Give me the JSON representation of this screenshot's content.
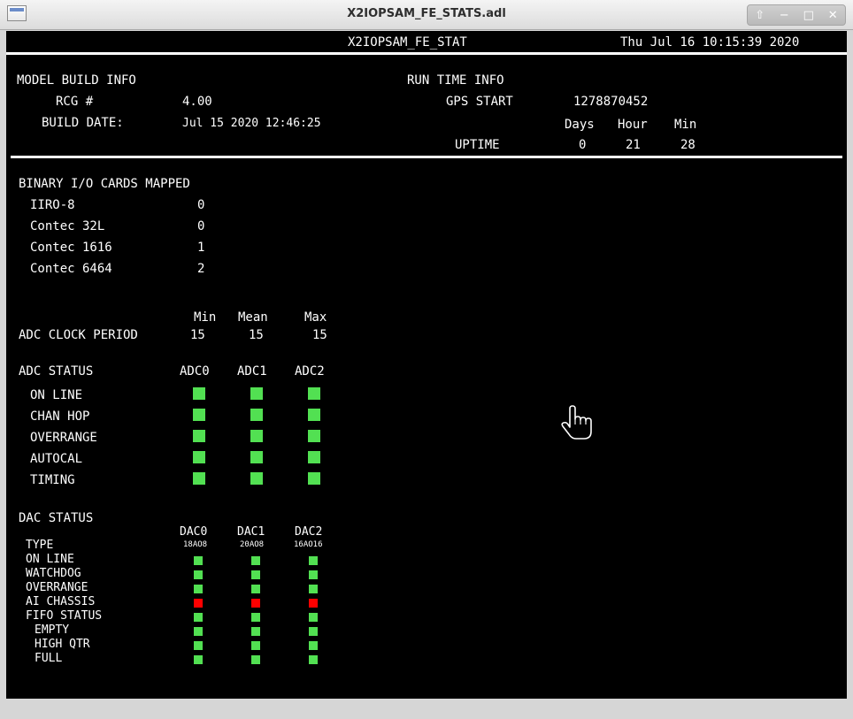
{
  "window": {
    "title": "X2IOPSAM_FE_STATS.adl",
    "controls": {
      "up": "⇧",
      "minimize": "−",
      "maximize": "□",
      "close": "✕"
    }
  },
  "header": {
    "name": "X2IOPSAM_FE_STAT",
    "datetime": "Thu Jul 16 10:15:39 2020"
  },
  "build_info": {
    "heading": "MODEL BUILD INFO",
    "rcg_label": "RCG #",
    "rcg_value": "4.00",
    "build_date_label": "BUILD DATE:",
    "build_date_value": "Jul 15 2020 12:46:25"
  },
  "runtime": {
    "heading": "RUN TIME INFO",
    "gps_label": "GPS START",
    "gps_value": "1278870452",
    "col_days": "Days",
    "col_hour": "Hour",
    "col_min": "Min",
    "uptime_label": "UPTIME",
    "days": "0",
    "hours": "21",
    "mins": "28"
  },
  "binary_io": {
    "heading": "BINARY I/O CARDS MAPPED",
    "cards": [
      {
        "label": "IIRO-8",
        "value": "0"
      },
      {
        "label": "Contec 32L",
        "value": "0"
      },
      {
        "label": "Contec 1616",
        "value": "1"
      },
      {
        "label": "Contec 6464",
        "value": "2"
      }
    ]
  },
  "adc_clock": {
    "label": "ADC CLOCK PERIOD",
    "col_min": "Min",
    "col_mean": "Mean",
    "col_max": "Max",
    "min": "15",
    "mean": "15",
    "max": "15"
  },
  "adc_status": {
    "heading": "ADC STATUS",
    "columns": [
      "ADC0",
      "ADC1",
      "ADC2"
    ],
    "rows": [
      "ON LINE",
      "CHAN HOP",
      "OVERRANGE",
      "AUTOCAL",
      "TIMING"
    ],
    "states": [
      [
        "ok",
        "ok",
        "ok"
      ],
      [
        "ok",
        "ok",
        "ok"
      ],
      [
        "ok",
        "ok",
        "ok"
      ],
      [
        "ok",
        "ok",
        "ok"
      ],
      [
        "ok",
        "ok",
        "ok"
      ]
    ]
  },
  "dac_status": {
    "heading": "DAC STATUS",
    "type_label": "TYPE",
    "columns": [
      "DAC0",
      "DAC1",
      "DAC2"
    ],
    "types": [
      "18AO8",
      "20AO8",
      "16AO16"
    ],
    "rows": [
      "ON LINE",
      "WATCHDOG",
      "OVERRANGE",
      "AI CHASSIS",
      "FIFO STATUS",
      "EMPTY",
      "HIGH QTR",
      "FULL"
    ],
    "states": [
      [
        "ok",
        "ok",
        "ok"
      ],
      [
        "ok",
        "ok",
        "ok"
      ],
      [
        "ok",
        "ok",
        "ok"
      ],
      [
        "fault",
        "fault",
        "fault"
      ],
      [
        "ok",
        "ok",
        "ok"
      ],
      [
        "ok",
        "ok",
        "ok"
      ],
      [
        "ok",
        "ok",
        "ok"
      ],
      [
        "ok",
        "ok",
        "ok"
      ]
    ]
  },
  "colors": {
    "ok": "#52e052",
    "fault": "#ff0000",
    "background": "#000000",
    "text": "#ffffff"
  },
  "cursor_icon": "hand-pointer-icon"
}
